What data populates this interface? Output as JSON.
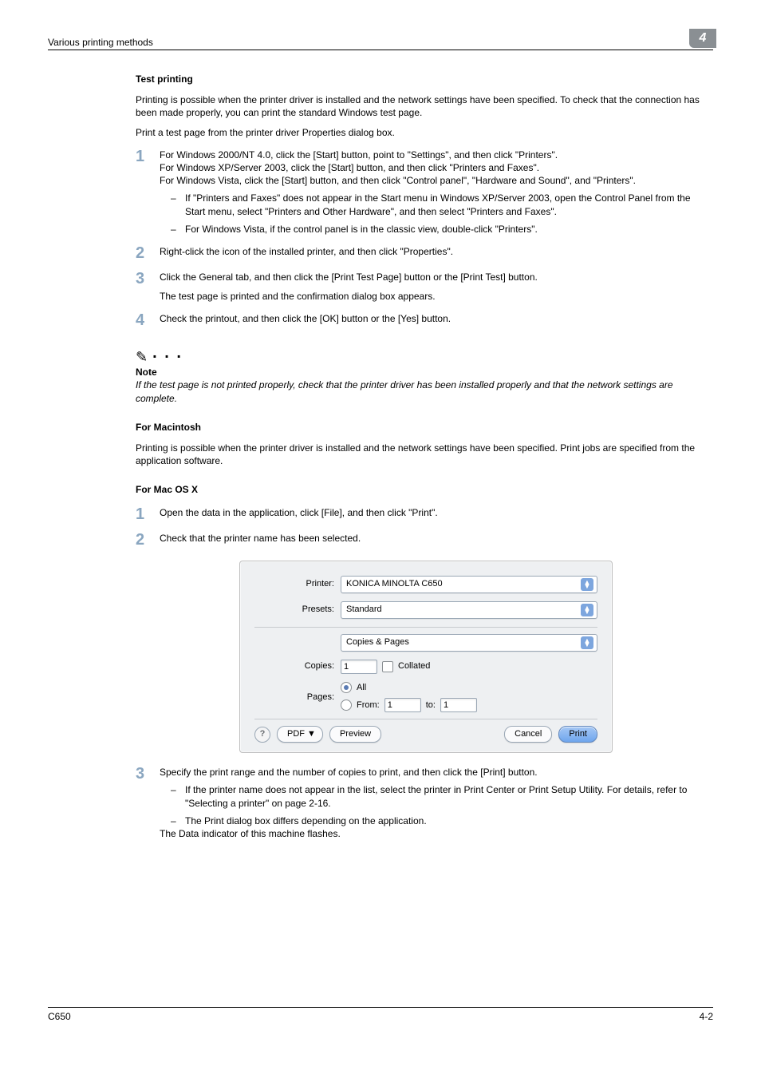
{
  "header": {
    "section_title": "Various printing methods",
    "chapter_number": "4"
  },
  "sections": {
    "test_printing": {
      "title": "Test printing",
      "intro1": "Printing is possible when the printer driver is installed and the network settings have been specified. To check that the connection has been made properly, you can print the standard Windows test page.",
      "intro2": "Print a test page from the printer driver Properties dialog box.",
      "steps": [
        {
          "num": "1",
          "lines": [
            "For Windows 2000/NT 4.0, click the [Start] button, point to \"Settings\", and then click \"Printers\".",
            "For Windows XP/Server 2003, click the [Start] button, and then click \"Printers and Faxes\".",
            "For Windows Vista, click the [Start] button, and then click \"Control panel\", \"Hardware and Sound\", and \"Printers\"."
          ],
          "subs": [
            "If \"Printers and Faxes\" does not appear in the Start menu in Windows XP/Server 2003, open the Control Panel from the Start menu, select \"Printers and Other Hardware\", and then select \"Printers and Faxes\".",
            "For Windows Vista, if the control panel is in the classic view, double-click \"Printers\"."
          ]
        },
        {
          "num": "2",
          "lines": [
            "Right-click the icon of the installed printer, and then click \"Properties\"."
          ]
        },
        {
          "num": "3",
          "lines": [
            "Click the General tab, and then click the [Print Test Page] button or the [Print Test] button."
          ],
          "after": "The test page is printed and the confirmation dialog box appears."
        },
        {
          "num": "4",
          "lines": [
            "Check the printout, and then click the [OK] button or the [Yes] button."
          ]
        }
      ],
      "note": {
        "label": "Note",
        "text": "If the test page is not printed properly, check that the printer driver has been installed properly and that the network settings are complete."
      }
    },
    "for_mac": {
      "title": "For Macintosh",
      "intro": "Printing is possible when the printer driver is installed and the network settings have been specified. Print jobs are specified from the application software."
    },
    "for_macosx": {
      "title": "For Mac OS X",
      "steps": [
        {
          "num": "1",
          "text": "Open the data in the application, click [File], and then click \"Print\"."
        },
        {
          "num": "2",
          "text": "Check that the printer name has been selected."
        },
        {
          "num": "3",
          "text": "Specify the print range and the number of copies to print, and then click the [Print] button.",
          "subs": [
            "If the printer name does not appear in the list, select the printer in Print Center or Print Setup Utility. For details, refer to \"Selecting a printer\" on page 2-16.",
            "The Print dialog box differs depending on the application."
          ],
          "after": "The Data indicator of this machine flashes."
        }
      ]
    }
  },
  "dialog": {
    "printer_label": "Printer:",
    "printer_value": "KONICA MINOLTA C650",
    "presets_label": "Presets:",
    "presets_value": "Standard",
    "section_value": "Copies & Pages",
    "copies_label": "Copies:",
    "copies_value": "1",
    "collated_label": "Collated",
    "pages_label": "Pages:",
    "pages_all": "All",
    "pages_from": "From:",
    "pages_from_value": "1",
    "pages_to": "to:",
    "pages_to_value": "1",
    "help": "?",
    "pdf": "PDF ▼",
    "preview": "Preview",
    "cancel": "Cancel",
    "print": "Print"
  },
  "footer": {
    "left": "C650",
    "right": "4-2"
  }
}
